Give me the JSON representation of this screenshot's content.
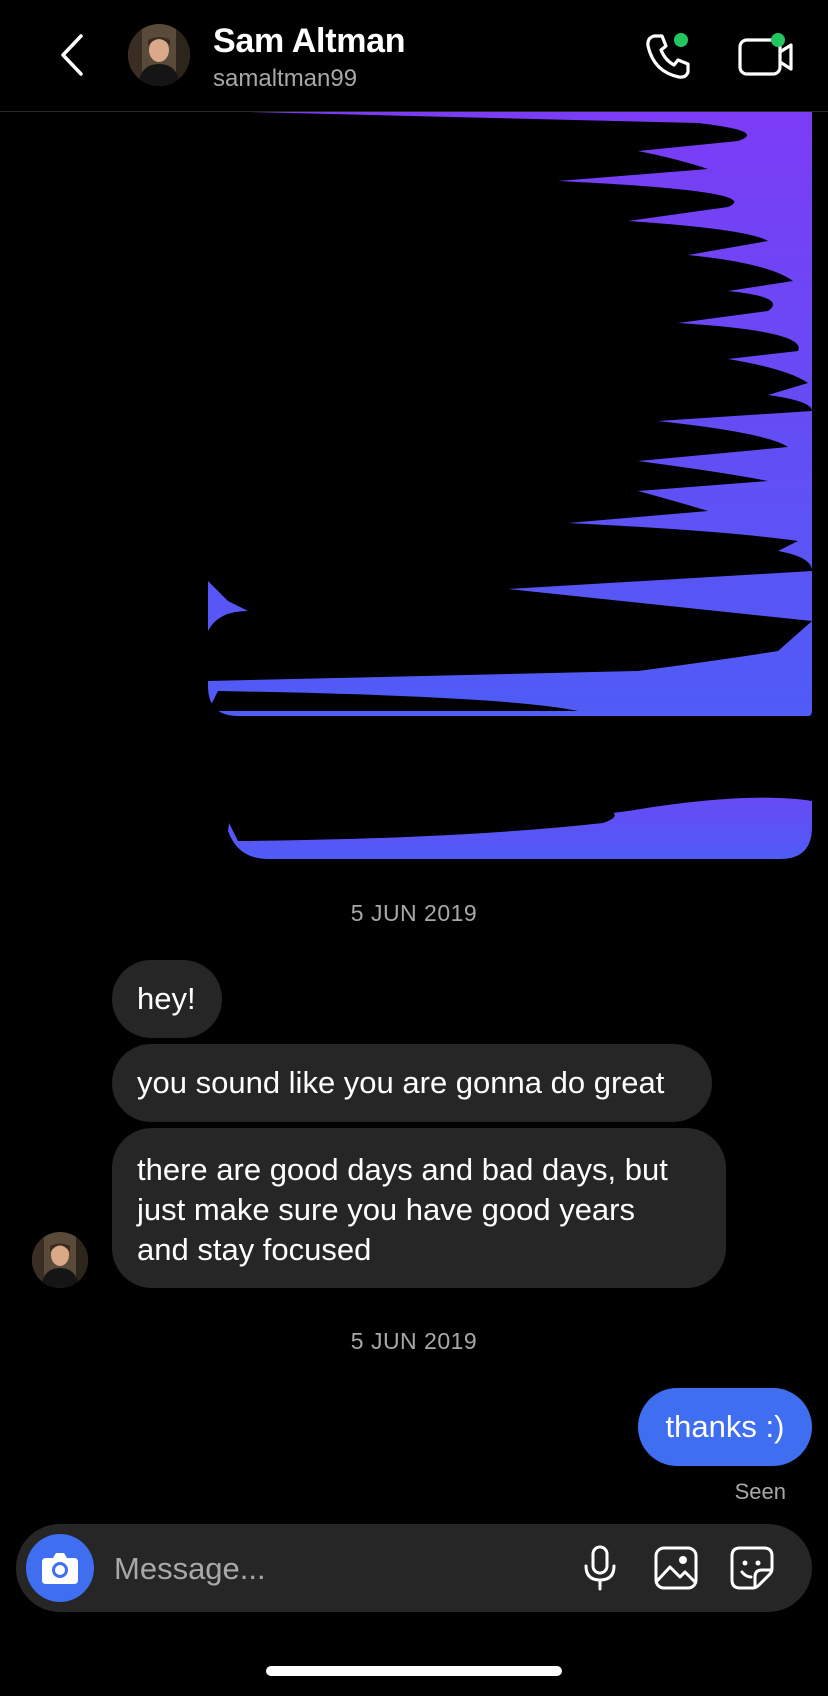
{
  "header": {
    "name": "Sam Altman",
    "username": "samaltman99",
    "online_color": "#22c55e"
  },
  "conversation": {
    "date_1": "5 JUN 2019",
    "incoming": [
      "hey!",
      "you sound like you are gonna do great",
      [
        "there are good days and bad days, but",
        "just make sure you have good years",
        "and stay focused"
      ]
    ],
    "date_2": "5 JUN 2019",
    "outgoing": "thanks :)",
    "seen": "Seen"
  },
  "composer": {
    "placeholder": "Message...",
    "accent": "#3f6ff0"
  },
  "icons": [
    "back-chevron-icon",
    "phone-icon",
    "video-camera-icon",
    "camera-icon",
    "microphone-icon",
    "gallery-icon",
    "sticker-icon"
  ]
}
